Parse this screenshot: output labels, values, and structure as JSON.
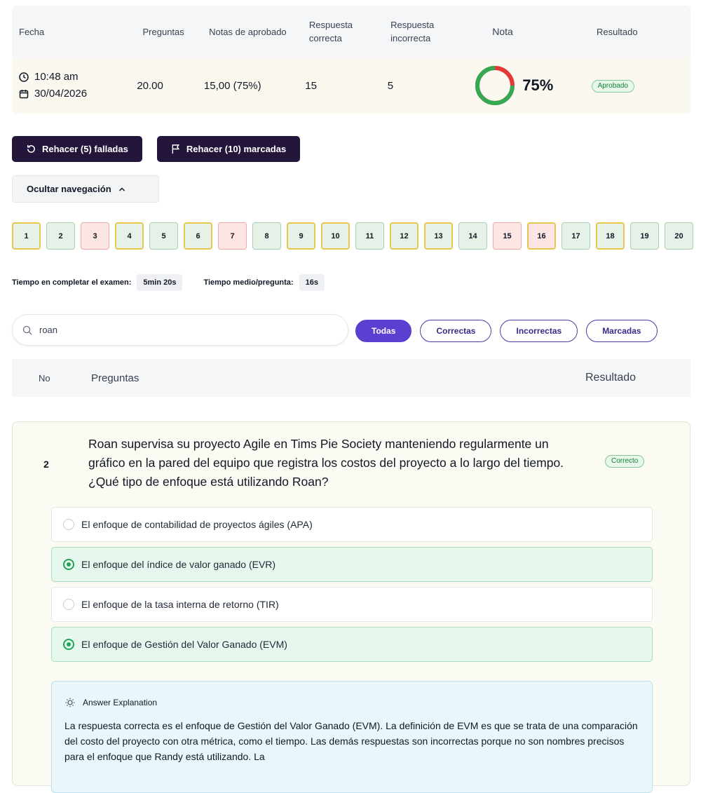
{
  "summary": {
    "headers": {
      "fecha": "Fecha",
      "preguntas": "Preguntas",
      "notas_aprobado": "Notas de aprobado",
      "respuesta_correcta": [
        "Respuesta",
        "correcta"
      ],
      "respuesta_incorrecta": [
        "Respuesta",
        "incorrecta"
      ],
      "nota": "Nota",
      "resultado": "Resultado"
    },
    "row": {
      "time": "10:48 am",
      "date": "30/04/2026",
      "preguntas": "20.00",
      "notas_aprobado": "15,00 (75%)",
      "correctas": "15",
      "incorrectas": "5",
      "nota": "75%",
      "nota_fraction": 0.75,
      "resultado": "Aprobado"
    }
  },
  "actions": {
    "retry_failed": "Rehacer (5) falladas",
    "retry_marked": "Rehacer (10) marcadas",
    "toggle_nav": "Ocultar navegación"
  },
  "question_nav": [
    {
      "n": "1",
      "status": "correct",
      "flagged": true
    },
    {
      "n": "2",
      "status": "correct",
      "flagged": false
    },
    {
      "n": "3",
      "status": "incorrect",
      "flagged": false
    },
    {
      "n": "4",
      "status": "correct",
      "flagged": true
    },
    {
      "n": "5",
      "status": "correct",
      "flagged": false
    },
    {
      "n": "6",
      "status": "correct",
      "flagged": true
    },
    {
      "n": "7",
      "status": "incorrect",
      "flagged": false
    },
    {
      "n": "8",
      "status": "correct",
      "flagged": false
    },
    {
      "n": "9",
      "status": "correct",
      "flagged": true
    },
    {
      "n": "10",
      "status": "correct",
      "flagged": true
    },
    {
      "n": "11",
      "status": "correct",
      "flagged": false
    },
    {
      "n": "12",
      "status": "correct",
      "flagged": true
    },
    {
      "n": "13",
      "status": "correct",
      "flagged": true
    },
    {
      "n": "14",
      "status": "correct",
      "flagged": false
    },
    {
      "n": "15",
      "status": "incorrect",
      "flagged": false
    },
    {
      "n": "16",
      "status": "incorrect",
      "flagged": true
    },
    {
      "n": "17",
      "status": "correct",
      "flagged": false
    },
    {
      "n": "18",
      "status": "correct",
      "flagged": true
    },
    {
      "n": "19",
      "status": "correct",
      "flagged": false
    },
    {
      "n": "20",
      "status": "correct",
      "flagged": false
    }
  ],
  "times": {
    "total_label": "Tiempo en completar el examen:",
    "total_value": "5min 20s",
    "avg_label": "Tiempo medio/pregunta:",
    "avg_value": "16s"
  },
  "search": {
    "value": "roan"
  },
  "filters": [
    "Todas",
    "Correctas",
    "Incorrectas",
    "Marcadas"
  ],
  "list_header": {
    "no": "No",
    "preguntas": "Preguntas",
    "resultado": "Resultado"
  },
  "question": {
    "number": "2",
    "text": "Roan supervisa su proyecto Agile en Tims Pie Society manteniendo regularmente un gráfico en la pared del equipo que registra los costos del proyecto a lo largo del tiempo. ¿Qué tipo de enfoque está utilizando Roan?",
    "result": "Correcto",
    "options": [
      {
        "text": "El enfoque de contabilidad de proyectos ágiles (APA)",
        "selected": false
      },
      {
        "text": "El enfoque del índice de valor ganado (EVR)",
        "selected": true
      },
      {
        "text": "El enfoque de la tasa interna de retorno (TIR)",
        "selected": false
      },
      {
        "text": "El enfoque de Gestión del Valor Ganado (EVM)",
        "selected": true
      }
    ],
    "explanation_title": "Answer Explanation",
    "explanation": "La respuesta correcta es el enfoque de Gestión del Valor Ganado (EVM). La definición de EVM es que se trata de una comparación del costo del proyecto con otra métrica, como el tiempo. Las demás respuestas son incorrectas porque no son nombres precisos para el enfoque que Randy está utilizando. La"
  },
  "colors": {
    "dark_button": "#24153b",
    "accent": "#5b3fd1",
    "correct_green": "#22a35a",
    "incorrect_red": "#e53935"
  }
}
